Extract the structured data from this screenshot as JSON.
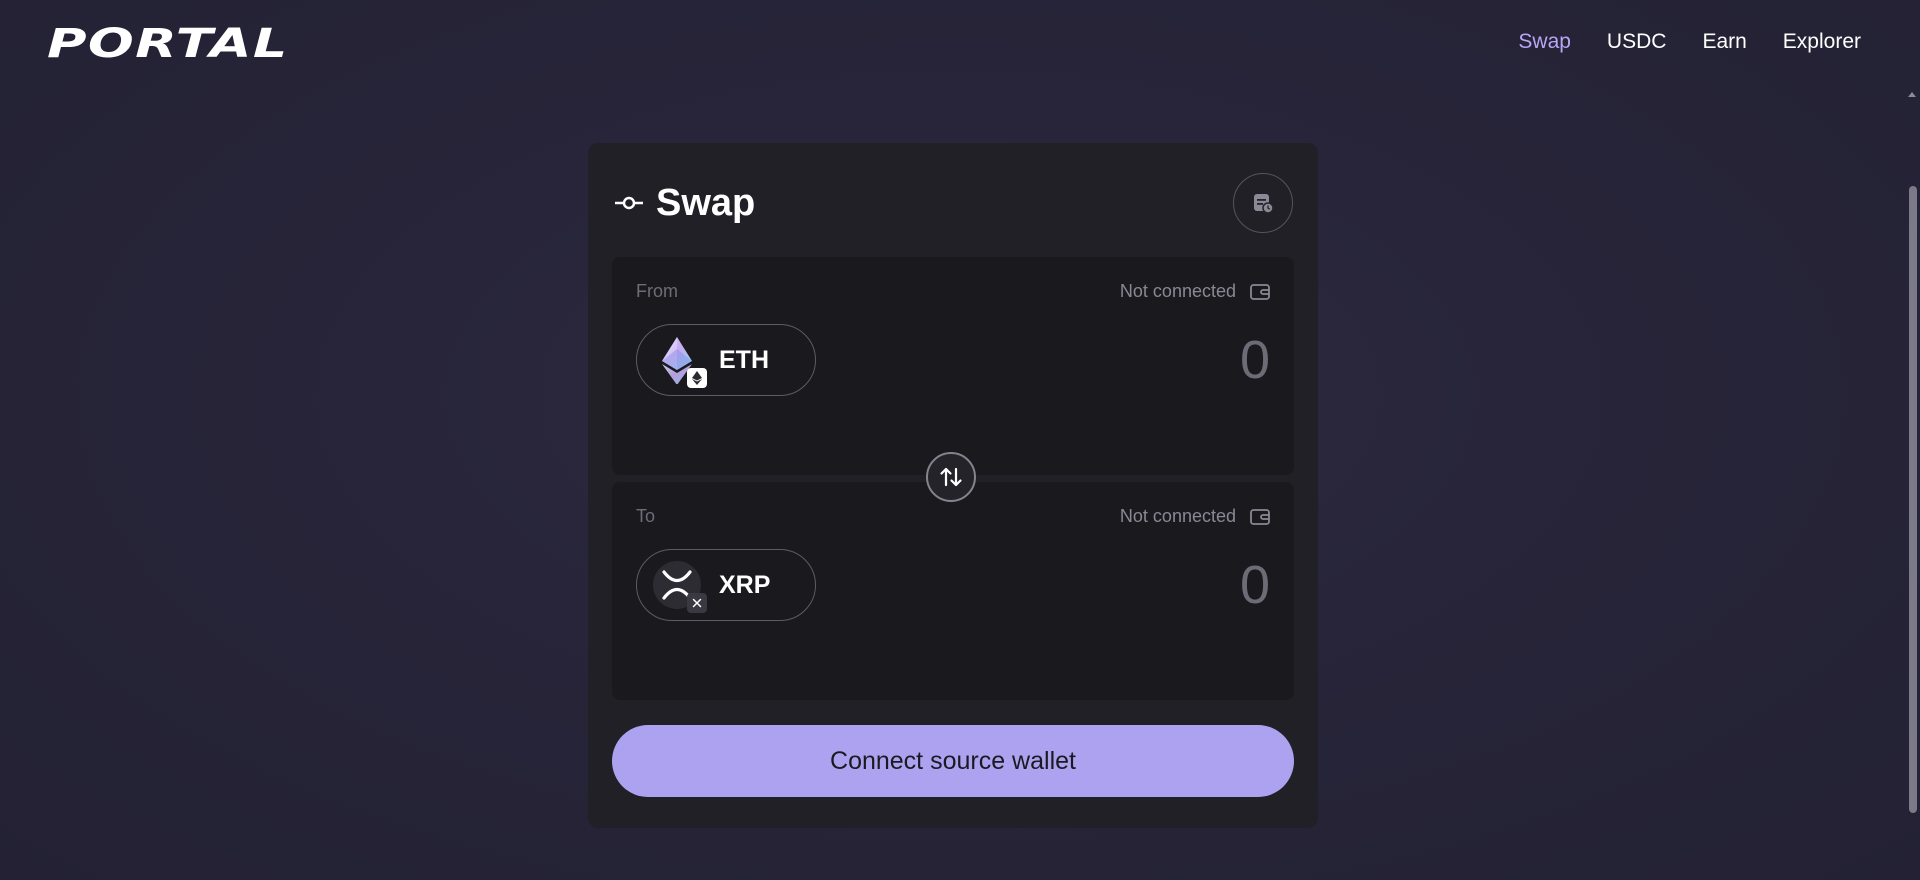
{
  "header": {
    "logo": "PORTAL",
    "nav": [
      {
        "label": "Swap",
        "active": true
      },
      {
        "label": "USDC",
        "active": false
      },
      {
        "label": "Earn",
        "active": false
      },
      {
        "label": "Explorer",
        "active": false
      }
    ]
  },
  "swap": {
    "title": "Swap",
    "from": {
      "label": "From",
      "status": "Not connected",
      "token": "ETH",
      "amount": "0"
    },
    "to": {
      "label": "To",
      "status": "Not connected",
      "token": "XRP",
      "amount": "0"
    },
    "connect_button": "Connect source wallet"
  },
  "colors": {
    "accent": "#ada2f0",
    "nav_active": "#b6a6f4",
    "card_bg": "#212027",
    "panel_bg": "#1a191e"
  },
  "icons": {
    "title": "commit-icon",
    "history": "history-icon",
    "wallet": "wallet-icon",
    "swap_direction": "swap-arrows-icon",
    "eth": "ethereum-icon",
    "xrp": "xrp-icon"
  }
}
